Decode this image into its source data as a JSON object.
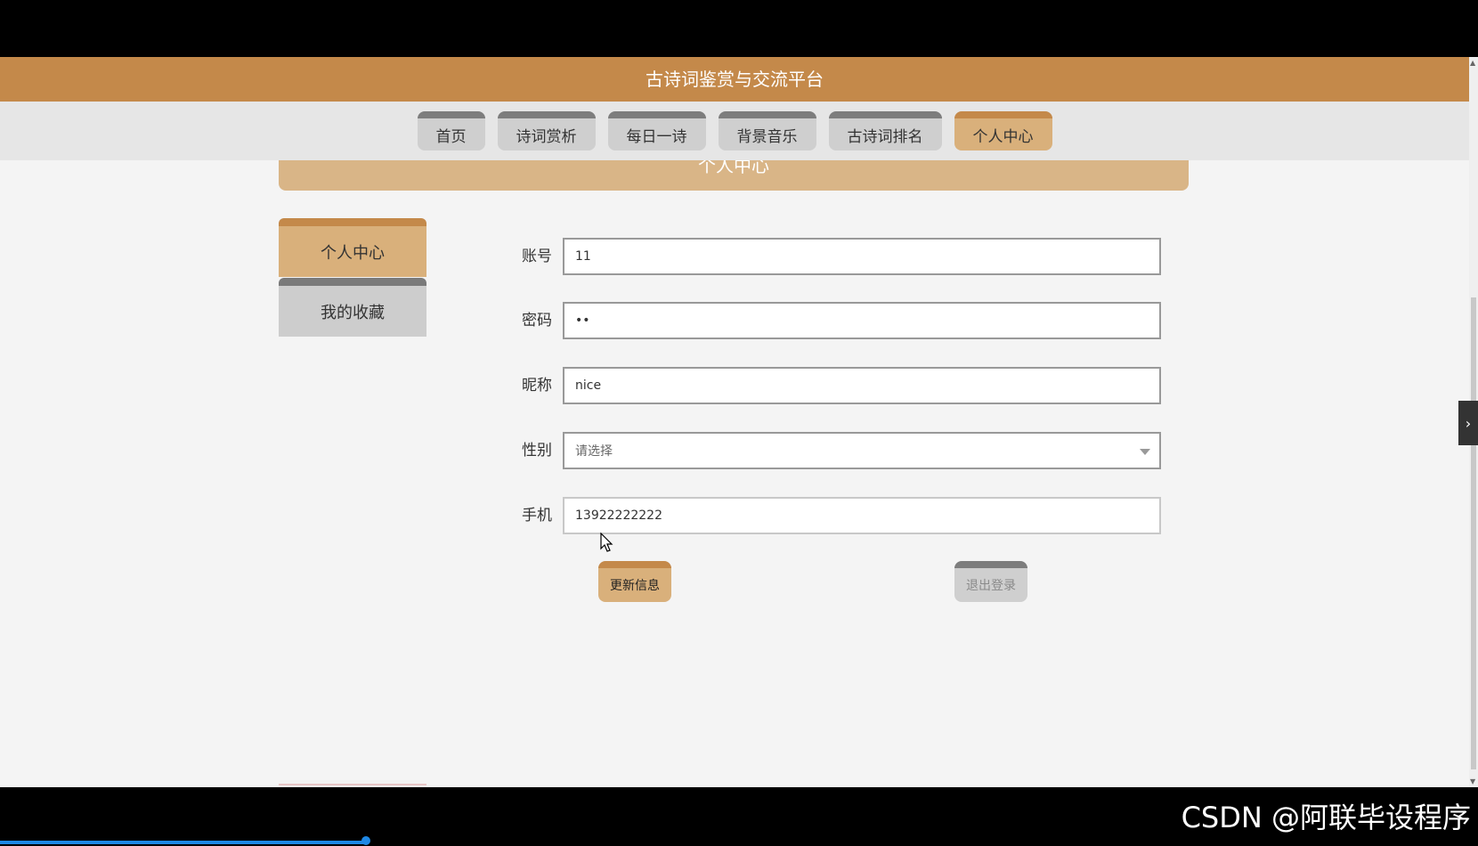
{
  "app": {
    "title": "古诗词鉴赏与交流平台"
  },
  "nav": {
    "tabs": [
      {
        "label": "首页",
        "active": false
      },
      {
        "label": "诗词赏析",
        "active": false
      },
      {
        "label": "每日一诗",
        "active": false
      },
      {
        "label": "背景音乐",
        "active": false
      },
      {
        "label": "古诗词排名",
        "active": false
      },
      {
        "label": "个人中心",
        "active": true
      }
    ]
  },
  "section": {
    "title": "个人中心"
  },
  "sidebar": {
    "items": [
      {
        "label": "个人中心",
        "active": true
      },
      {
        "label": "我的收藏",
        "active": false
      }
    ]
  },
  "form": {
    "account": {
      "label": "账号",
      "value": "11"
    },
    "password": {
      "label": "密码",
      "value": "••"
    },
    "nickname": {
      "label": "昵称",
      "value": "nice"
    },
    "gender": {
      "label": "性别",
      "placeholder": "请选择"
    },
    "phone": {
      "label": "手机",
      "value": "13922222222"
    }
  },
  "actions": {
    "update_label": "更新信息",
    "logout_label": "退出登录"
  },
  "watermark": {
    "text": "CSDN @阿联毕设程序"
  },
  "colors": {
    "brand": "#c4894a",
    "brand_light": "#d9b07b"
  },
  "icons": {
    "scroll_up": "triangle-up-icon",
    "scroll_down": "triangle-down-icon",
    "drawer": "chevron-right-icon",
    "select": "caret-down-icon"
  }
}
